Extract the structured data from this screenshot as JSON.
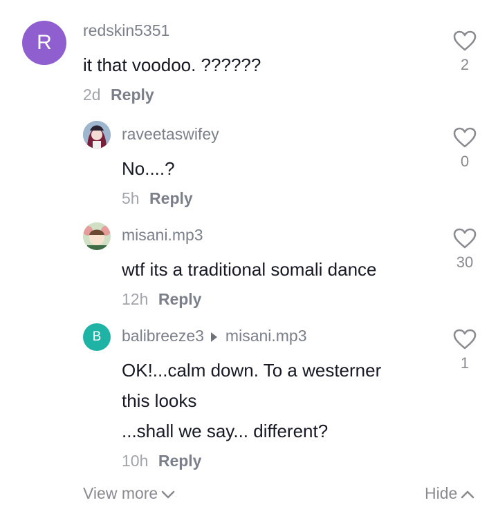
{
  "comments": [
    {
      "avatar_letter": "R",
      "username": "redskin5351",
      "text": "it that voodoo. ??????",
      "age": "2d",
      "reply_label": "Reply",
      "likes": "2"
    },
    {
      "username": "raveetaswifey",
      "text": "No....?",
      "age": "5h",
      "reply_label": "Reply",
      "likes": "0"
    },
    {
      "username": "misani.mp3",
      "text": "wtf its a traditional somali dance",
      "age": "12h",
      "reply_label": "Reply",
      "likes": "30"
    },
    {
      "avatar_letter": "B",
      "username": "balibreeze3",
      "reply_to": "misani.mp3",
      "text_lines": [
        "OK!...calm down. To a westerner",
        "this looks",
        "...shall we say... different?"
      ],
      "age": "10h",
      "reply_label": "Reply",
      "likes": "1"
    }
  ],
  "footer": {
    "view_more": "View more",
    "hide": "Hide"
  },
  "colors": {
    "avatar_r": "#8f5fd0",
    "avatar_b": "#1fb3a5",
    "muted_text": "#7b7f89"
  }
}
